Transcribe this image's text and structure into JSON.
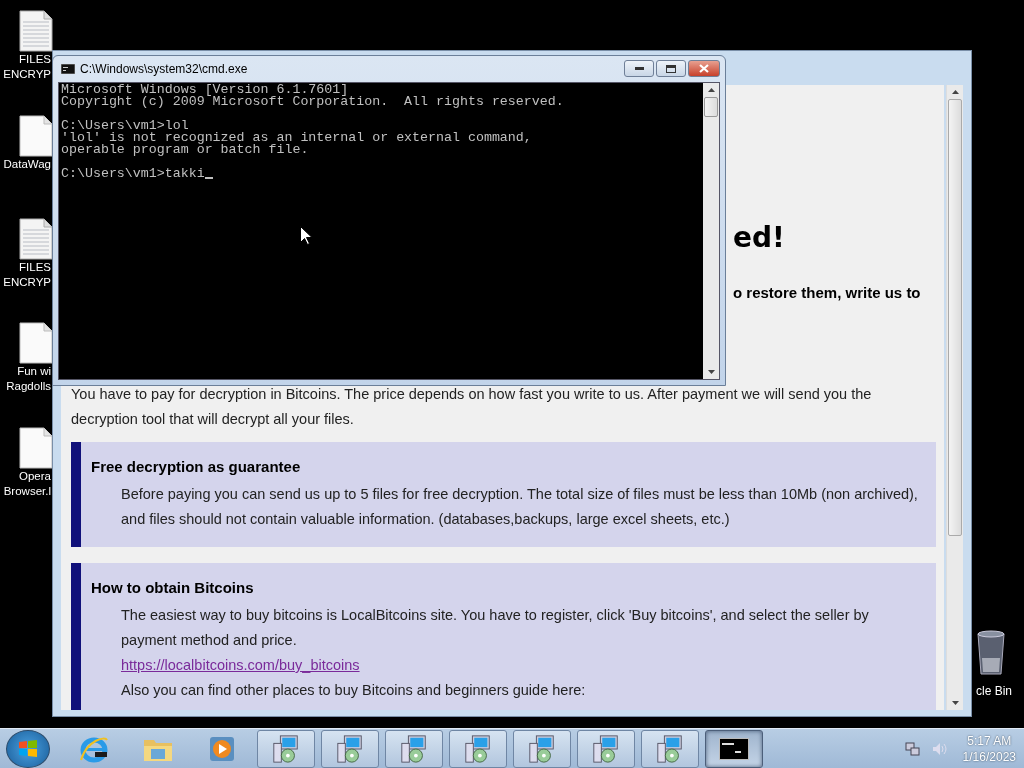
{
  "desktop_icons": [
    {
      "kind": "text-file",
      "label": "FILES\nENCRYP"
    },
    {
      "kind": "blank-file",
      "label": "DataWag"
    },
    {
      "kind": "text-file",
      "label": "FILES\nENCRYP"
    },
    {
      "kind": "blank-file",
      "label": "Fun wi\nRagdolls"
    },
    {
      "kind": "blank-file",
      "label": "Opera\nBrowser.l"
    }
  ],
  "recycle_bin": {
    "label": "cle Bin"
  },
  "note_window": {
    "heading": "ed!",
    "subheading": "o restore them, write us to",
    "paragraph": "You have to pay for decryption in Bitcoins. The price depends on how fast you write to us. After payment we will send you the decryption tool that will decrypt all your files.",
    "sections": [
      {
        "title": "Free decryption as guarantee",
        "items": [
          {
            "kind": "text",
            "text": "Before paying you can send us up to 5 files for free decryption. The total size of files must be less than 10Mb (non archived), and files should not contain valuable information. (databases,backups, large excel sheets, etc.)"
          }
        ]
      },
      {
        "title": "How to obtain Bitcoins",
        "items": [
          {
            "kind": "text",
            "text": "The easiest way to buy bitcoins is LocalBitcoins site. You have to register, click 'Buy bitcoins', and select the seller by payment method and price."
          },
          {
            "kind": "link",
            "text": "https://localbitcoins.com/buy_bitcoins"
          },
          {
            "kind": "text",
            "text": "Also you can find other places to buy Bitcoins and beginners guide here:"
          }
        ]
      }
    ]
  },
  "cmd_window": {
    "title": "C:\\Windows\\system32\\cmd.exe",
    "blocks": [
      [
        "Microsoft Windows [Version 6.1.7601]",
        "Copyright (c) 2009 Microsoft Corporation.  All rights reserved."
      ],
      [
        "C:\\Users\\vm1>lol",
        "'lol' is not recognized as an internal or external command,",
        "operable program or batch file."
      ]
    ],
    "input": "C:\\Users\\vm1>takki"
  },
  "taskbar": {
    "buttons": [
      {
        "kind": "browser",
        "selected": false
      },
      {
        "kind": "folder",
        "selected": false
      },
      {
        "kind": "media",
        "selected": false
      },
      {
        "kind": "installer",
        "selected": false
      },
      {
        "kind": "installer",
        "selected": false
      },
      {
        "kind": "installer",
        "selected": false
      },
      {
        "kind": "installer",
        "selected": false
      },
      {
        "kind": "installer",
        "selected": false
      },
      {
        "kind": "installer",
        "selected": false
      },
      {
        "kind": "installer",
        "selected": false
      },
      {
        "kind": "console",
        "selected": true
      }
    ],
    "time": "5:17 AM",
    "date": "1/16/2023"
  }
}
